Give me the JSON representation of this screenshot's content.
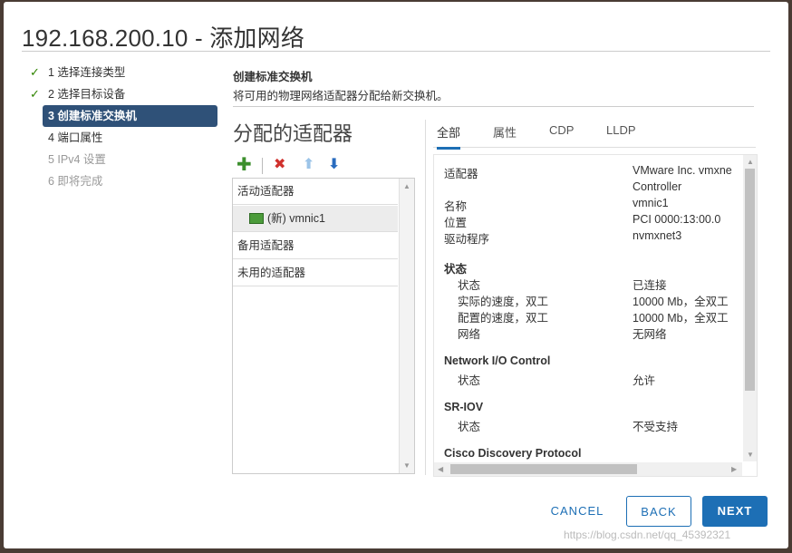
{
  "dialog": {
    "title": "192.168.200.10 - 添加网络"
  },
  "steps": [
    {
      "label": "1 选择连接类型",
      "done": true
    },
    {
      "label": "2 选择目标设备",
      "done": true
    },
    {
      "label": "3 创建标准交换机",
      "active": true
    },
    {
      "label": "4 端口属性"
    },
    {
      "label": "5 IPv4 设置",
      "disabled": true
    },
    {
      "label": "6 即将完成",
      "disabled": true
    }
  ],
  "section": {
    "title": "创建标准交换机",
    "description": "将可用的物理网络适配器分配给新交换机。"
  },
  "left_panel": {
    "title": "分配的适配器",
    "toolbar": {
      "add": "add-icon",
      "remove": "remove-icon",
      "move_up": "arrow-up-icon",
      "move_down": "arrow-down-icon"
    },
    "rows": {
      "active_group": "活动适配器",
      "nic": "(新) vmnic1",
      "standby_group": "备用适配器",
      "unused_group": "未用的适配器"
    }
  },
  "tabs": [
    "全部",
    "属性",
    "CDP",
    "LLDP"
  ],
  "details": {
    "adapter_label": "适配器",
    "adapter_value_1": "VMware Inc. vmxne",
    "adapter_value_2": "Controller",
    "name_label": "名称",
    "name_value": "vmnic1",
    "location_label": "位置",
    "location_value": "PCI 0000:13:00.0",
    "driver_label": "驱动程序",
    "driver_value": "nvmxnet3",
    "status_heading": "状态",
    "status_label": "状态",
    "status_value": "已连接",
    "actual_speed_label": "实际的速度，双工",
    "actual_speed_value": "10000 Mb，全双工",
    "config_speed_label": "配置的速度，双工",
    "config_speed_value": "10000 Mb，全双工",
    "network_label": "网络",
    "network_value": "无网络",
    "nioc_heading": "Network I/O Control",
    "nioc_status_label": "状态",
    "nioc_status_value": "允许",
    "sriov_heading": "SR-IOV",
    "sriov_status_label": "状态",
    "sriov_status_value": "不受支持",
    "cdp_heading": "Cisco Discovery Protocol"
  },
  "buttons": {
    "cancel": "CANCEL",
    "back": "BACK",
    "next": "NEXT"
  },
  "watermark": "https://blog.csdn.net/qq_45392321"
}
